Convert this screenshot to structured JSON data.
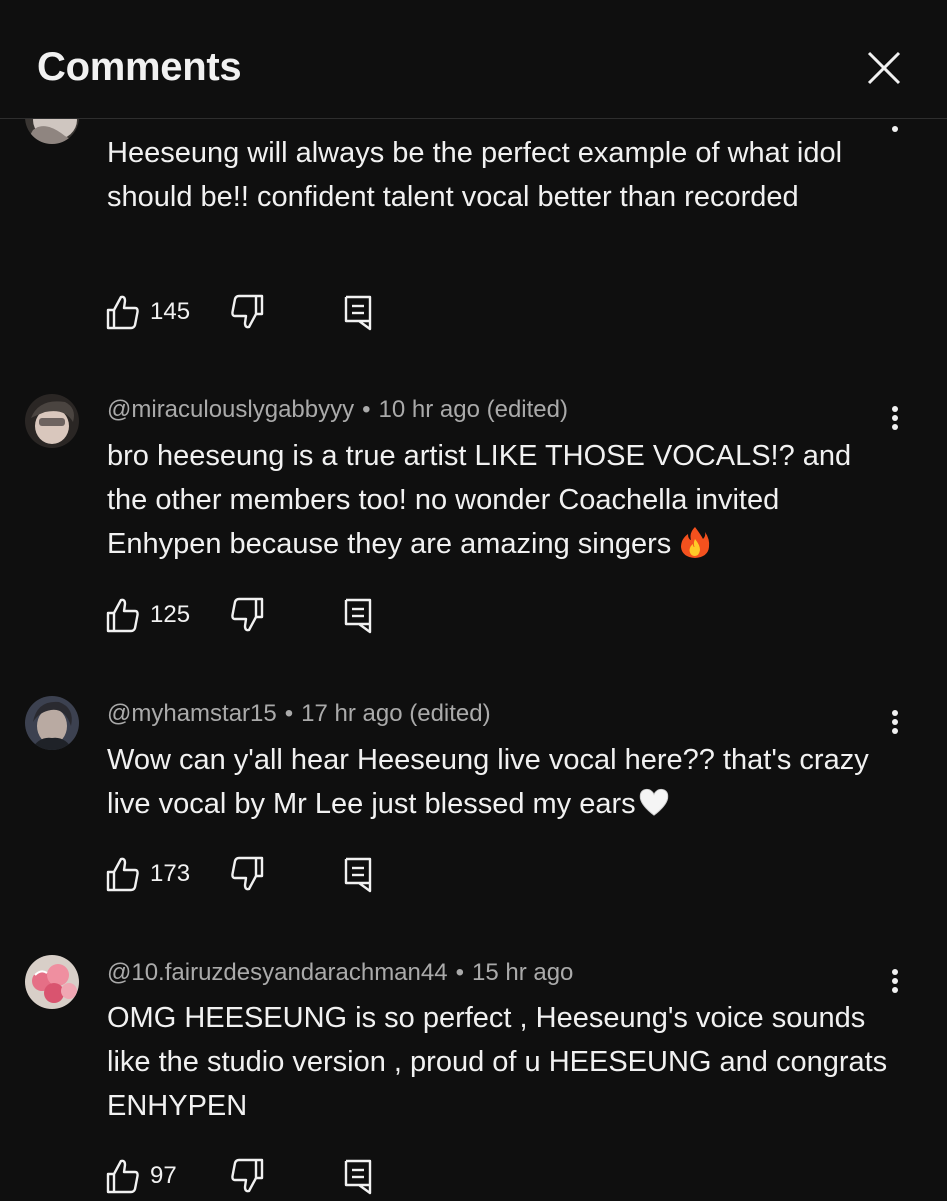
{
  "header": {
    "title": "Comments"
  },
  "comments": [
    {
      "username": "",
      "time": "",
      "text": "Heeseung will always be the perfect example of what idol should be!! confident talent vocal better than recorded",
      "likes": "145",
      "avatar_color": "#cfc6c0"
    },
    {
      "username": "@miraculouslygabbyyy",
      "separator": "•",
      "time": "10 hr ago (edited)",
      "text": "bro heeseung is a true artist LIKE THOSE VOCALS!? and the other members too! no wonder Coachella invited Enhypen because they are amazing singers",
      "emoji": "fire-emoji",
      "likes": "125",
      "avatar_color": "#b8a9a0"
    },
    {
      "username": "@myhamstar15",
      "separator": "•",
      "time": "17 hr ago (edited)",
      "text": "Wow can y'all hear Heeseung live vocal here?? that's crazy live vocal by Mr Lee just blessed my ears",
      "emoji": "white-heart-emoji",
      "likes": "173",
      "avatar_color": "#6d6a78"
    },
    {
      "username": "@10.fairuzdesyandarachman44",
      "separator": "•",
      "time": "15 hr ago",
      "text": "OMG HEESEUNG is so perfect , Heeseung's voice sounds like the studio version , proud of u HEESEUNG and congrats ENHYPEN",
      "likes": "97",
      "avatar_color": "#e8a9b0"
    }
  ],
  "colors": {
    "background": "#0f0f0f",
    "text": "#f1f1f1",
    "meta": "#aaaaaa"
  }
}
